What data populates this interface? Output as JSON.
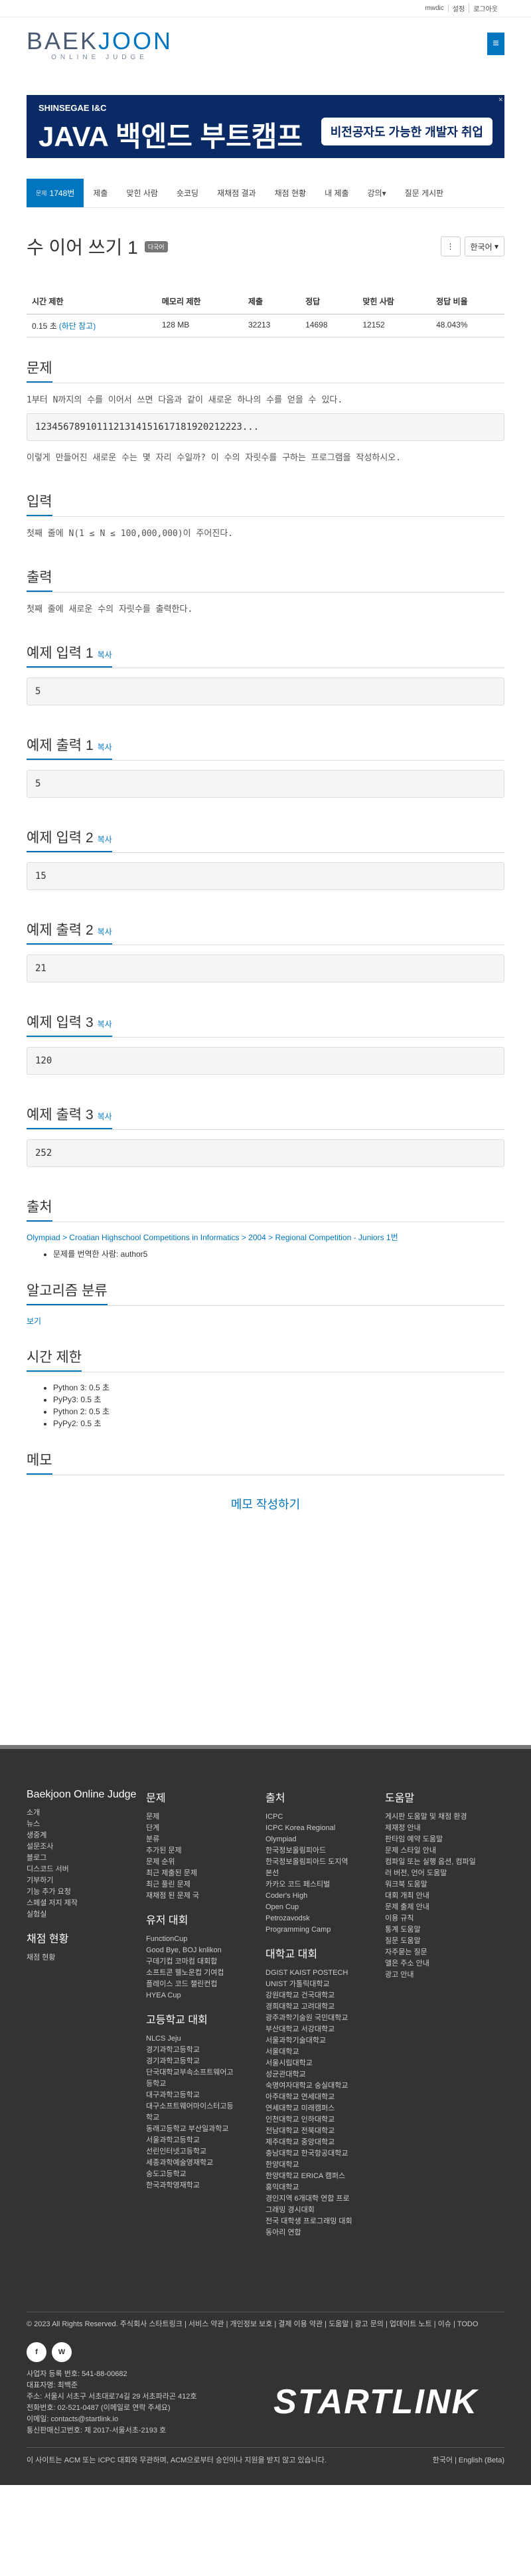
{
  "topbar": [
    "mwdic",
    "설정",
    "로그아웃"
  ],
  "logo": {
    "main_left": "BAEK",
    "main_right": "JOON",
    "sub": "ONLINE JUDGE"
  },
  "ad": {
    "brand": "SHINSEGAE I&C",
    "title": "JAVA 백엔드 부트캠프",
    "box": "비전공자도 가능한 개발자 취업"
  },
  "tabs": [
    {
      "sub": "문제",
      "label": "1748번"
    },
    {
      "label": "제출"
    },
    {
      "label": "맞힌 사람"
    },
    {
      "label": "숏코딩"
    },
    {
      "label": "재채점 결과"
    },
    {
      "label": "채점 현황"
    },
    {
      "label": "내 제출"
    },
    {
      "label": "강의▾"
    },
    {
      "label": "질문 게시판"
    }
  ],
  "problem": {
    "title": "수 이어 쓰기 1",
    "badge": "다국어",
    "lang": "한국어",
    "lang_icon": "⋮"
  },
  "stats": {
    "headers": [
      "시간 제한",
      "메모리 제한",
      "제출",
      "정답",
      "맞힌 사람",
      "정답 비율"
    ],
    "row": [
      "0.15 초",
      "128 MB",
      "32213",
      "14698",
      "12152",
      "48.043%"
    ],
    "extra": "(하단 참고)"
  },
  "sections": {
    "problem": "문제",
    "input": "입력",
    "output": "출력",
    "source": "출처",
    "algo": "알고리즘 분류",
    "time": "시간 제한",
    "memo": "메모"
  },
  "problem_text": "1부터 N까지의 수를 이어서 쓰면 다음과 같이 새로운 하나의 수를 얻을 수 있다.",
  "problem_seq": "1234567891011121314151617181920212223...",
  "problem_q": "이렇게 만들어진 새로운 수는 몇 자리 수일까? 이 수의 자릿수를 구하는 프로그램을 작성하시오.",
  "input_text": "첫째 줄에 N(1 ≤ N ≤ 100,000,000)이 주어진다.",
  "output_text": "첫째 줄에 새로운 수의 자릿수를 출력한다.",
  "samples": [
    {
      "in_label": "예제 입력 1",
      "out_label": "예제 출력 1",
      "in": "5",
      "out": "5"
    },
    {
      "in_label": "예제 입력 2",
      "out_label": "예제 출력 2",
      "in": "15",
      "out": "21"
    },
    {
      "in_label": "예제 입력 3",
      "out_label": "예제 출력 3",
      "in": "120",
      "out": "252"
    }
  ],
  "copy": "복사",
  "source": {
    "path": "Olympiad > Croatian Highschool Competitions in Informatics > 2004 > Regional Competition - Juniors 1번",
    "maker": "문제를 번역한 사람: author5"
  },
  "algo_link": "보기",
  "time_items": [
    "Python 3: 0.5 초",
    "PyPy3: 0.5 초",
    "Python 2: 0.5 초",
    "PyPy2: 0.5 초"
  ],
  "memo_btn": "메모 작성하기",
  "footer": {
    "c1_title": "Baekjoon Online Judge",
    "c1": [
      "소개",
      "뉴스",
      "생중계",
      "설문조사",
      "블로그",
      "디스코드 서버",
      "기부하기",
      "기능 추가 요청",
      "스페셜 저지 제작",
      "실험실"
    ],
    "c1_sub": "채점 현황",
    "c1b": [
      "채점 현황"
    ],
    "c2_title": "문제",
    "c2": [
      "문제",
      "단계",
      "분류",
      "추가된 문제",
      "문제 순위",
      "최근 제출된 문제",
      "최근 풀린 문제",
      "재채점 된 문제 국"
    ],
    "c2_sub": "유저 대회",
    "c2b": [
      "FunctionCup",
      "Good Bye, BOJ knlikon",
      "구데기컵 코마컴 대회합",
      "소프트콘 웰노운컵 기여컵",
      "플레이스 코드 챌린컨컵",
      "HYEA Cup"
    ],
    "c2_sub2": "고등학교 대회",
    "c2c": [
      "NLCS Jeju",
      "경기과학고등학교",
      "경기과학고등학교",
      "단국대학교부속소프트웨어고",
      "등학교",
      "대구과학고등학교",
      "대구소프트웨어마이스터고등",
      "학교",
      "동래고등학교 부산일과학교",
      "서울과학고등학교",
      "선린인터넷고등학교",
      "세종과학예술영재학교",
      "숭도고등학교",
      "한국과학영재학교"
    ],
    "c3_title": "출처",
    "c3": [
      "ICPC",
      "ICPC Korea Regional",
      "Olympiad",
      "한국정보올림피아드",
      "한국정보올림피아드 도지역",
      "본선",
      "카카오 코드 페스티벌",
      "Coder's High",
      "Open Cup",
      "Petrozavodsk",
      "Programming Camp"
    ],
    "c3_sub": "대학교 대회",
    "c3b": [
      "DGIST KAIST POSTECH",
      "UNIST 가톨릭대학교",
      "강원대학교 건국대학교",
      "경희대학교 고려대학교",
      "광주과학기술원 국민대학교",
      "부산대학교 서강대학교",
      "서울과학기술대학교",
      "서울대학교",
      "서울시립대학교",
      "성균관대학교",
      "숙명여자대학교 숭실대학교",
      "아주대학교 연세대학교",
      "연세대학교 미래캠퍼스",
      "인천대학교 인하대학교",
      "전남대학교 전북대학교",
      "제주대학교 중앙대학교",
      "충남대학교 한국항공대학교",
      "한양대학교",
      "한양대학교 ERICA 캠퍼스",
      "홍익대학교",
      "경인지역 6개대학 연합 프로",
      "그래밍 경시대회",
      "전국 대학생 프로그래밍 대회",
      "동아리 연합"
    ],
    "c4_title": "도움말",
    "c4": [
      "게시판 도움말 및 채점 환경",
      "제재정 안내",
      "판타임 예약 도움말",
      "문제 스타일 안내",
      "컴파일 또는 실행 옵션, 컴파일",
      "러 버전, 언어 도움말",
      "워크북 도움말",
      "대회 개최 안내",
      "문제 출제 안내",
      "이용 규칙",
      "통계 도움말",
      "질문 도움말",
      "자주묻는 질문",
      "앨은 주소 안내",
      "광고 안내"
    ],
    "links": "© 2023 All Rights Reserved. 주식회사 스타트링크  |  서비스 약관  |  개인정보 보호  |  결제 이용 약관  |  도움말  |  광고 문의  |  업데이트 노트  |  이슈  |  TODO",
    "biz": [
      "사업자 등록 번호: 541-88-00682",
      "대표자명: 최백준",
      "주소: 서울시 서초구 서초대로74길 29 서초파라곤 412호",
      "전화번호: 02-521-0487 (이메일로 연락 주세요)",
      "이메일: contacts@startlink.io",
      "통신판매신고번호: 제 2017-서울서초-2193 호"
    ],
    "brand": "STARTLINK",
    "notice": "이 사이트는 ACM 또는 ICPC 대회와 무관하며, ACM으로부터 승인이나 지원을 받지 않고 있습니다.",
    "langs": "한국어  |  English (Beta)"
  }
}
